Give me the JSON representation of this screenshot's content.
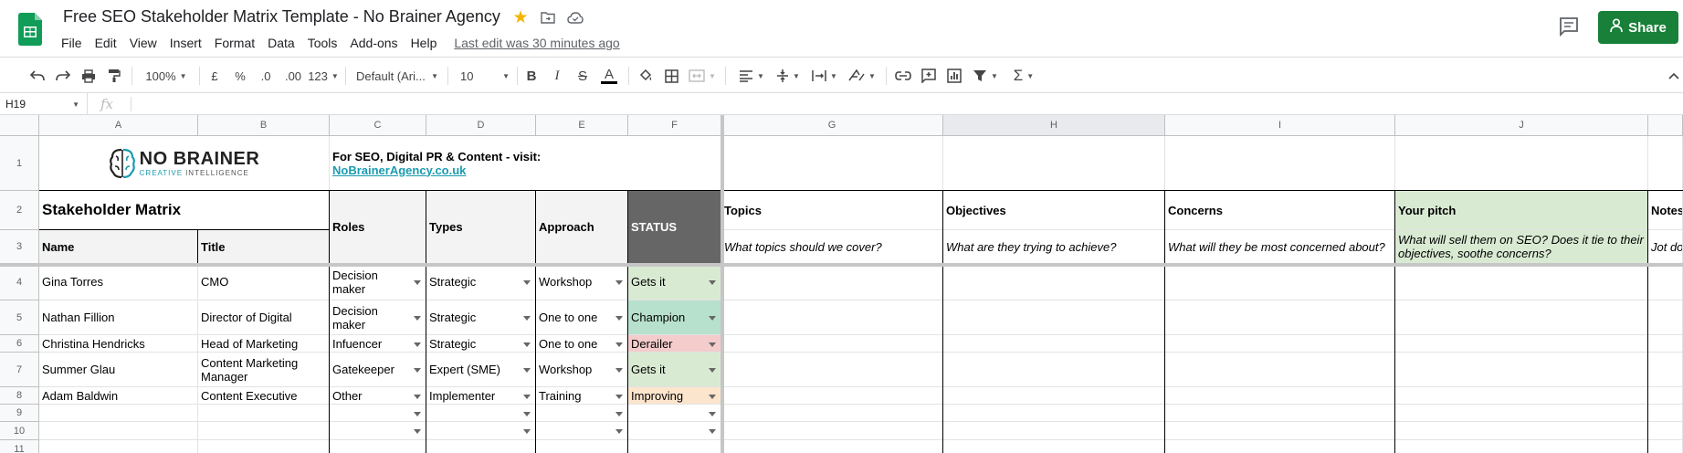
{
  "doc": {
    "title": "Free SEO Stakeholder Matrix Template - No Brainer Agency",
    "last_edit": "Last edit was 30 minutes ago"
  },
  "menu": [
    "File",
    "Edit",
    "View",
    "Insert",
    "Format",
    "Data",
    "Tools",
    "Add-ons",
    "Help"
  ],
  "share_label": "Share",
  "toolbar": {
    "zoom": "100%",
    "currency": "£",
    "percent": "%",
    "dec_decrease": ".0",
    "dec_increase": ".00",
    "number_format": "123",
    "font_family": "Default (Ari...",
    "font_size": "10",
    "bold": "B",
    "italic": "I",
    "strike": "S",
    "text_color": "A"
  },
  "formula_bar": {
    "cell_ref": "H19",
    "fx": "fx"
  },
  "columns": [
    "A",
    "B",
    "C",
    "D",
    "E",
    "F",
    "G",
    "H",
    "I",
    "J"
  ],
  "rows": [
    "1",
    "2",
    "3",
    "4",
    "5",
    "6",
    "7",
    "8",
    "9",
    "10",
    "11"
  ],
  "sheet": {
    "brand_name": "NO BRAINER",
    "brand_sub_creative": "CREATIVE",
    "brand_sub_intel": "INTELLIGENCE",
    "promo_text": "For SEO, Digital PR & Content - visit:",
    "promo_link": "NoBrainerAgency.co.uk",
    "matrix_title": "Stakeholder Matrix",
    "headers": {
      "name": "Name",
      "title": "Title",
      "roles": "Roles",
      "types": "Types",
      "approach": "Approach",
      "status": "STATUS",
      "topics": "Topics",
      "objectives": "Objectives",
      "concerns": "Concerns",
      "pitch": "Your pitch",
      "notes": "Notes"
    },
    "prompts": {
      "topics": "What topics should we cover?",
      "objectives": "What are they trying to achieve?",
      "concerns": "What will they be most concerned about?",
      "pitch": "What will sell them on SEO? Does it tie to their objectives, soothe concerns?",
      "notes": "Jot do"
    },
    "rows": [
      {
        "name": "Gina Torres",
        "title": "CMO",
        "role": "Decision maker",
        "type": "Strategic",
        "approach": "Workshop",
        "status": "Gets it"
      },
      {
        "name": "Nathan Fillion",
        "title": "Director of Digital",
        "role": "Decision maker",
        "type": "Strategic",
        "approach": "One to one",
        "status": "Champion"
      },
      {
        "name": "Christina Hendricks",
        "title": "Head of Marketing",
        "role": "Infuencer",
        "type": "Strategic",
        "approach": "One to one",
        "status": "Derailer"
      },
      {
        "name": "Summer Glau",
        "title": "Content Marketing Manager",
        "role": "Gatekeeper",
        "type": "Expert (SME)",
        "approach": "Workshop",
        "status": "Gets it"
      },
      {
        "name": "Adam Baldwin",
        "title": "Content Executive",
        "role": "Other",
        "type": "Implementer",
        "approach": "Training",
        "status": "Improving"
      }
    ]
  },
  "colors": {
    "share": "#188038",
    "status_header": "#666666",
    "gets_it": "#d9ead3",
    "champion": "#b7e1cd",
    "derailer": "#f4cccc",
    "improving": "#fce5cd",
    "pitch_bg": "#d9ead3",
    "link": "#1a9bb0"
  }
}
